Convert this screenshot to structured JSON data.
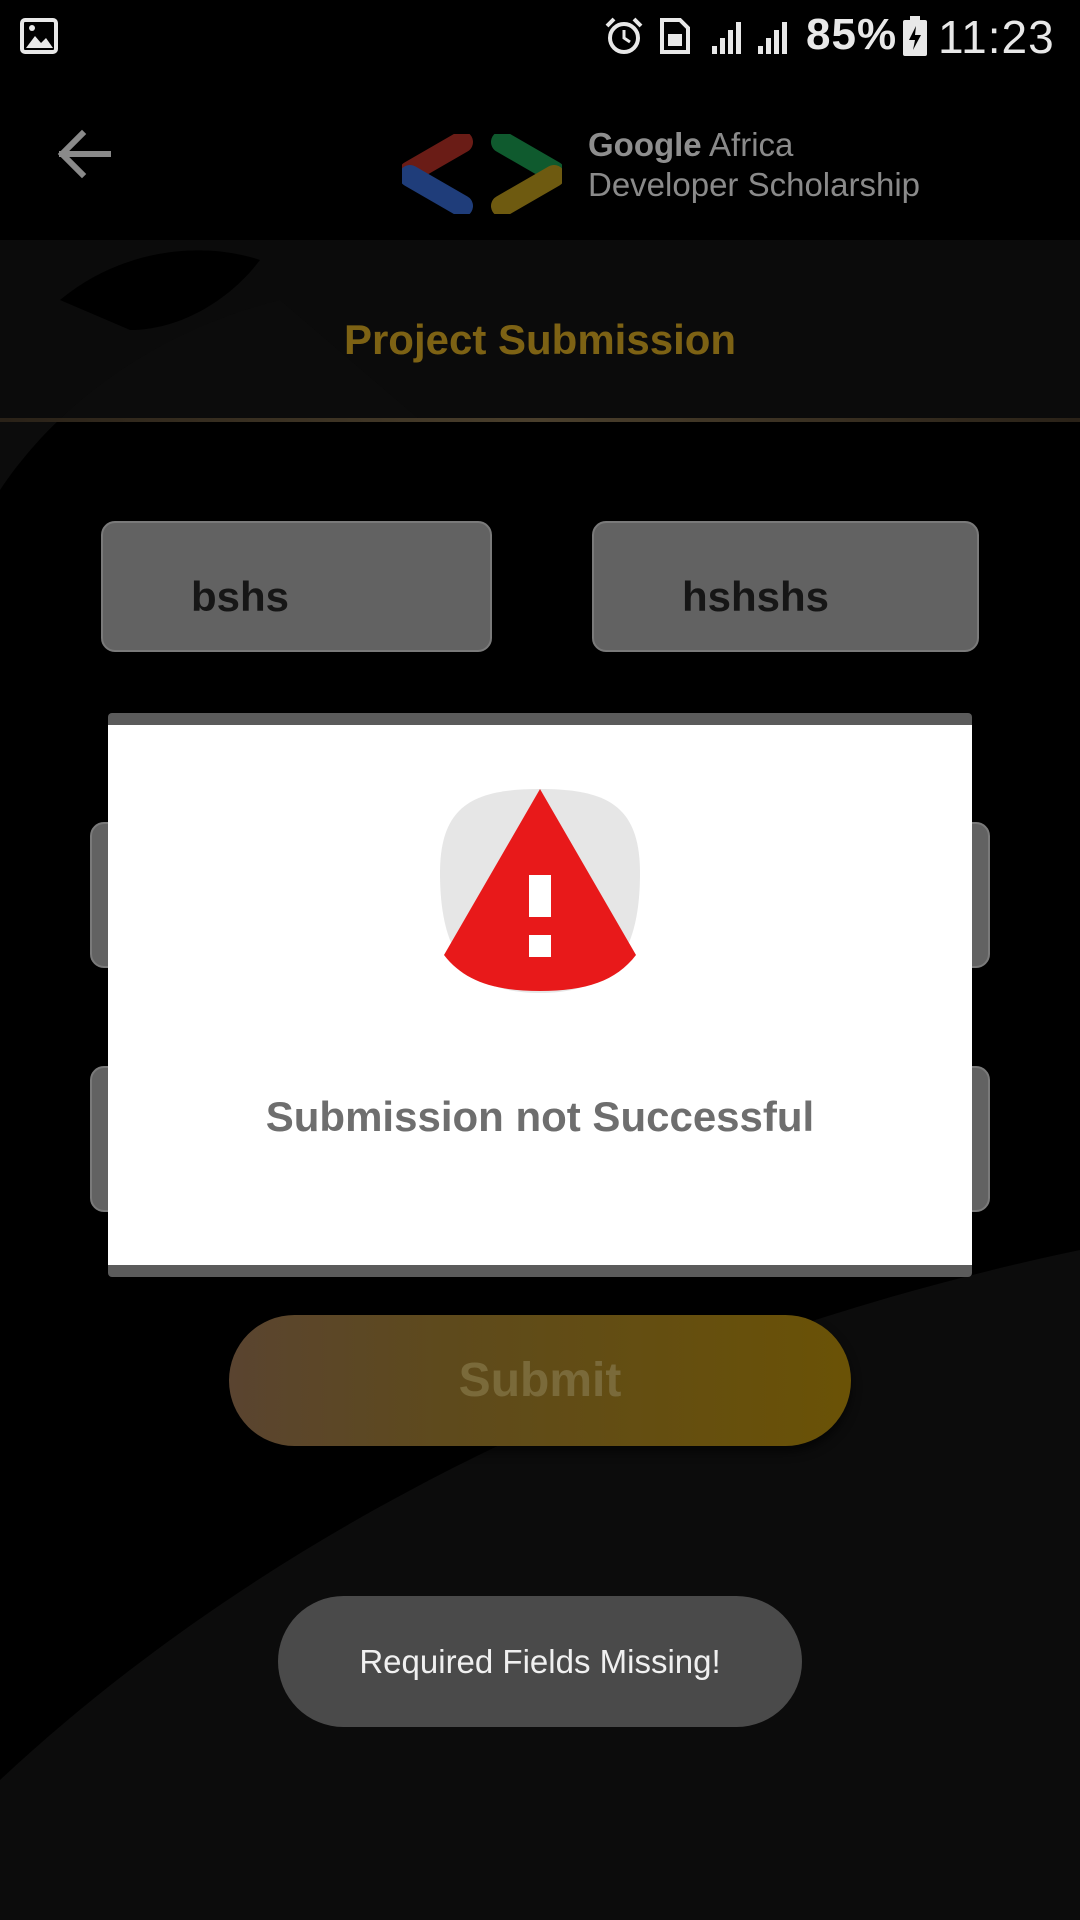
{
  "status_bar": {
    "battery_percent": "85%",
    "time": "11:23",
    "icons": [
      "gallery-icon",
      "alarm-icon",
      "sim-icon",
      "signal-icon",
      "signal-icon",
      "battery-charging-icon"
    ]
  },
  "header": {
    "back_icon": "arrow-back-icon",
    "logo_brand": "Google",
    "logo_word": "Africa",
    "logo_line2": "Developer Scholarship",
    "page_title": "Project Submission"
  },
  "form": {
    "first_name_value": "bshs",
    "last_name_value": "hshshs",
    "submit_label": "Submit"
  },
  "dialog": {
    "icon": "warning-icon",
    "message": "Submission not Successful"
  },
  "toast": {
    "message": "Required Fields Missing!"
  },
  "colors": {
    "accent_gold": "#b98e1c",
    "warning_red": "#e8191a",
    "background": "#000000"
  }
}
